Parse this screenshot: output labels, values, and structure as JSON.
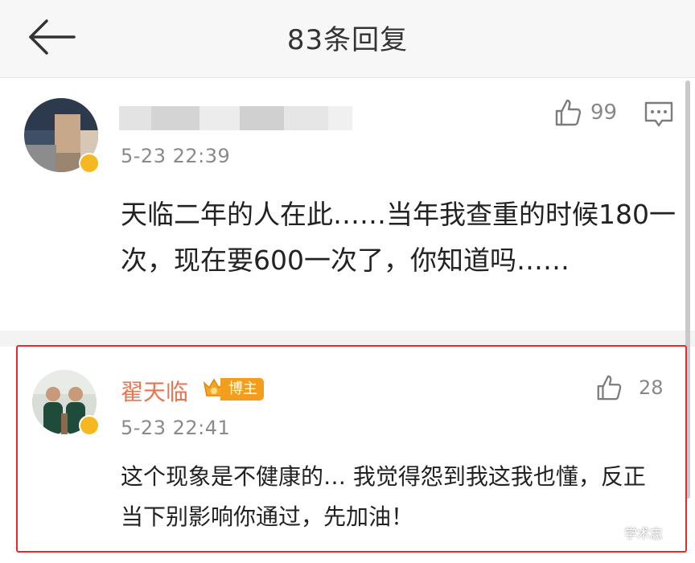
{
  "header": {
    "title": "83条回复",
    "back_icon": "arrow-left-icon"
  },
  "comments": [
    {
      "user_name": "",
      "time": "5-23 22:39",
      "likes": "99",
      "text": "天临二年的人在此……当年我查重的时候180一次，现在要600一次了，你知道吗……",
      "avatar_icon": "avatar-blurred",
      "actions": [
        "thumbs-up-icon",
        "reply-icon"
      ]
    },
    {
      "user_name": "翟天临",
      "badge": "博主",
      "time": "5-23 22:41",
      "likes": "28",
      "text": "这个现象是不健康的… 我觉得怨到我这我也懂，反正当下别影响你通过，先加油！",
      "avatar_icon": "avatar-two-people",
      "highlight_color": "#e52b2b",
      "name_color": "#eb7350"
    }
  ],
  "watermark": {
    "text": "学术志",
    "icon": "wechat-icon"
  }
}
